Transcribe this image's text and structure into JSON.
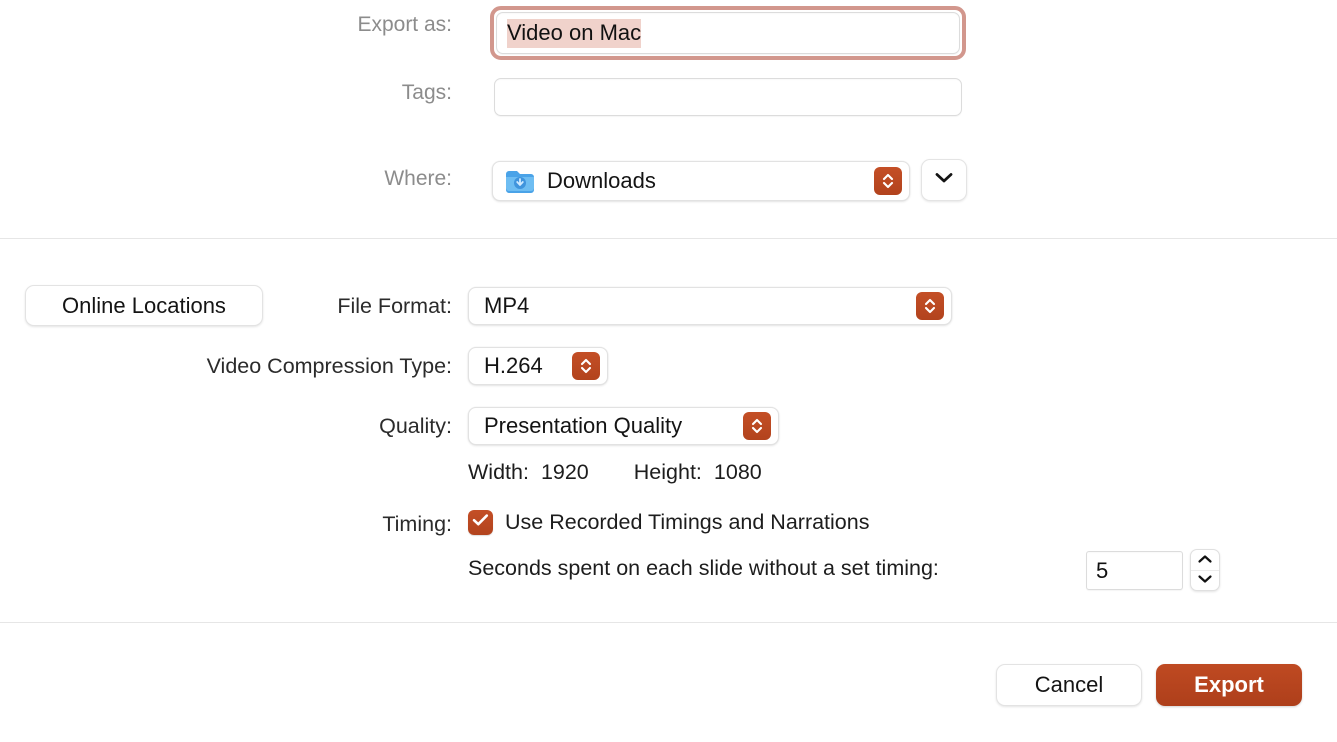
{
  "dialog": {
    "title": "Export",
    "accent_color": "#b8441f",
    "focus_ring_color": "#d2978d",
    "selection_color": "#f0d2cb"
  },
  "save_section": {
    "export_as": {
      "label": "Export as:",
      "value": "Video on Mac",
      "placeholder": "",
      "focused": "true",
      "selected": "true"
    },
    "tags": {
      "label": "Tags:",
      "value": "",
      "placeholder": ""
    },
    "where": {
      "label": "Where:",
      "value": "Downloads",
      "icon": "downloads-folder-icon",
      "popup_icon": "updown-chevron-icon",
      "disclosure_icon": "chevron-down-icon"
    }
  },
  "options_section": {
    "online_locations_label": "Online Locations",
    "file_format": {
      "label": "File Format:",
      "value": "MP4"
    },
    "video_compression": {
      "label": "Video Compression Type:",
      "value": "H.264"
    },
    "quality": {
      "label": "Quality:",
      "value": "Presentation Quality"
    },
    "dimensions": {
      "width_label": "Width:",
      "width_value": "1920",
      "height_label": "Height:",
      "height_value": "1080"
    },
    "timing": {
      "label": "Timing:",
      "checkbox_label": "Use Recorded Timings and Narrations",
      "checked": "true",
      "seconds_label": "Seconds spent on each slide without a set timing:",
      "seconds_value": "5",
      "stepper_up_icon": "chevron-up-icon",
      "stepper_down_icon": "chevron-down-icon"
    }
  },
  "footer": {
    "cancel_label": "Cancel",
    "export_label": "Export"
  }
}
